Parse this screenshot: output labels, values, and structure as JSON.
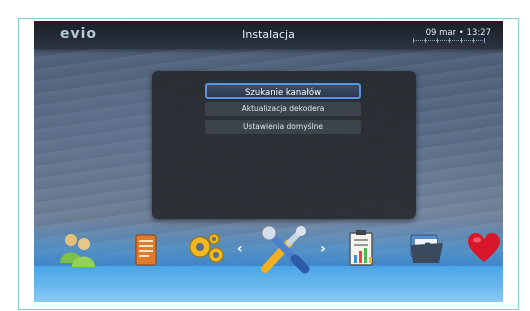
{
  "header": {
    "logo": "evio",
    "title": "Instalacja",
    "datetime": "09 mar • 13:27"
  },
  "menu": {
    "items": [
      {
        "label": "Szukanie kanałów",
        "selected": true
      },
      {
        "label": "Aktualizacja dekodera",
        "selected": false
      },
      {
        "label": "Ustawienia domyślne",
        "selected": false
      }
    ]
  },
  "dock": {
    "icons": [
      "users-icon",
      "notepad-icon",
      "settings-gears-icon",
      "tools-icon",
      "clipboard-chart-icon",
      "help-folder-icon",
      "heart-icon"
    ],
    "selected": "tools-icon",
    "left_arrow": "‹",
    "right_arrow": "›"
  },
  "colors": {
    "accent": "#5a95df",
    "topbar": "#1a1f27",
    "dock": "#49a5e6"
  }
}
